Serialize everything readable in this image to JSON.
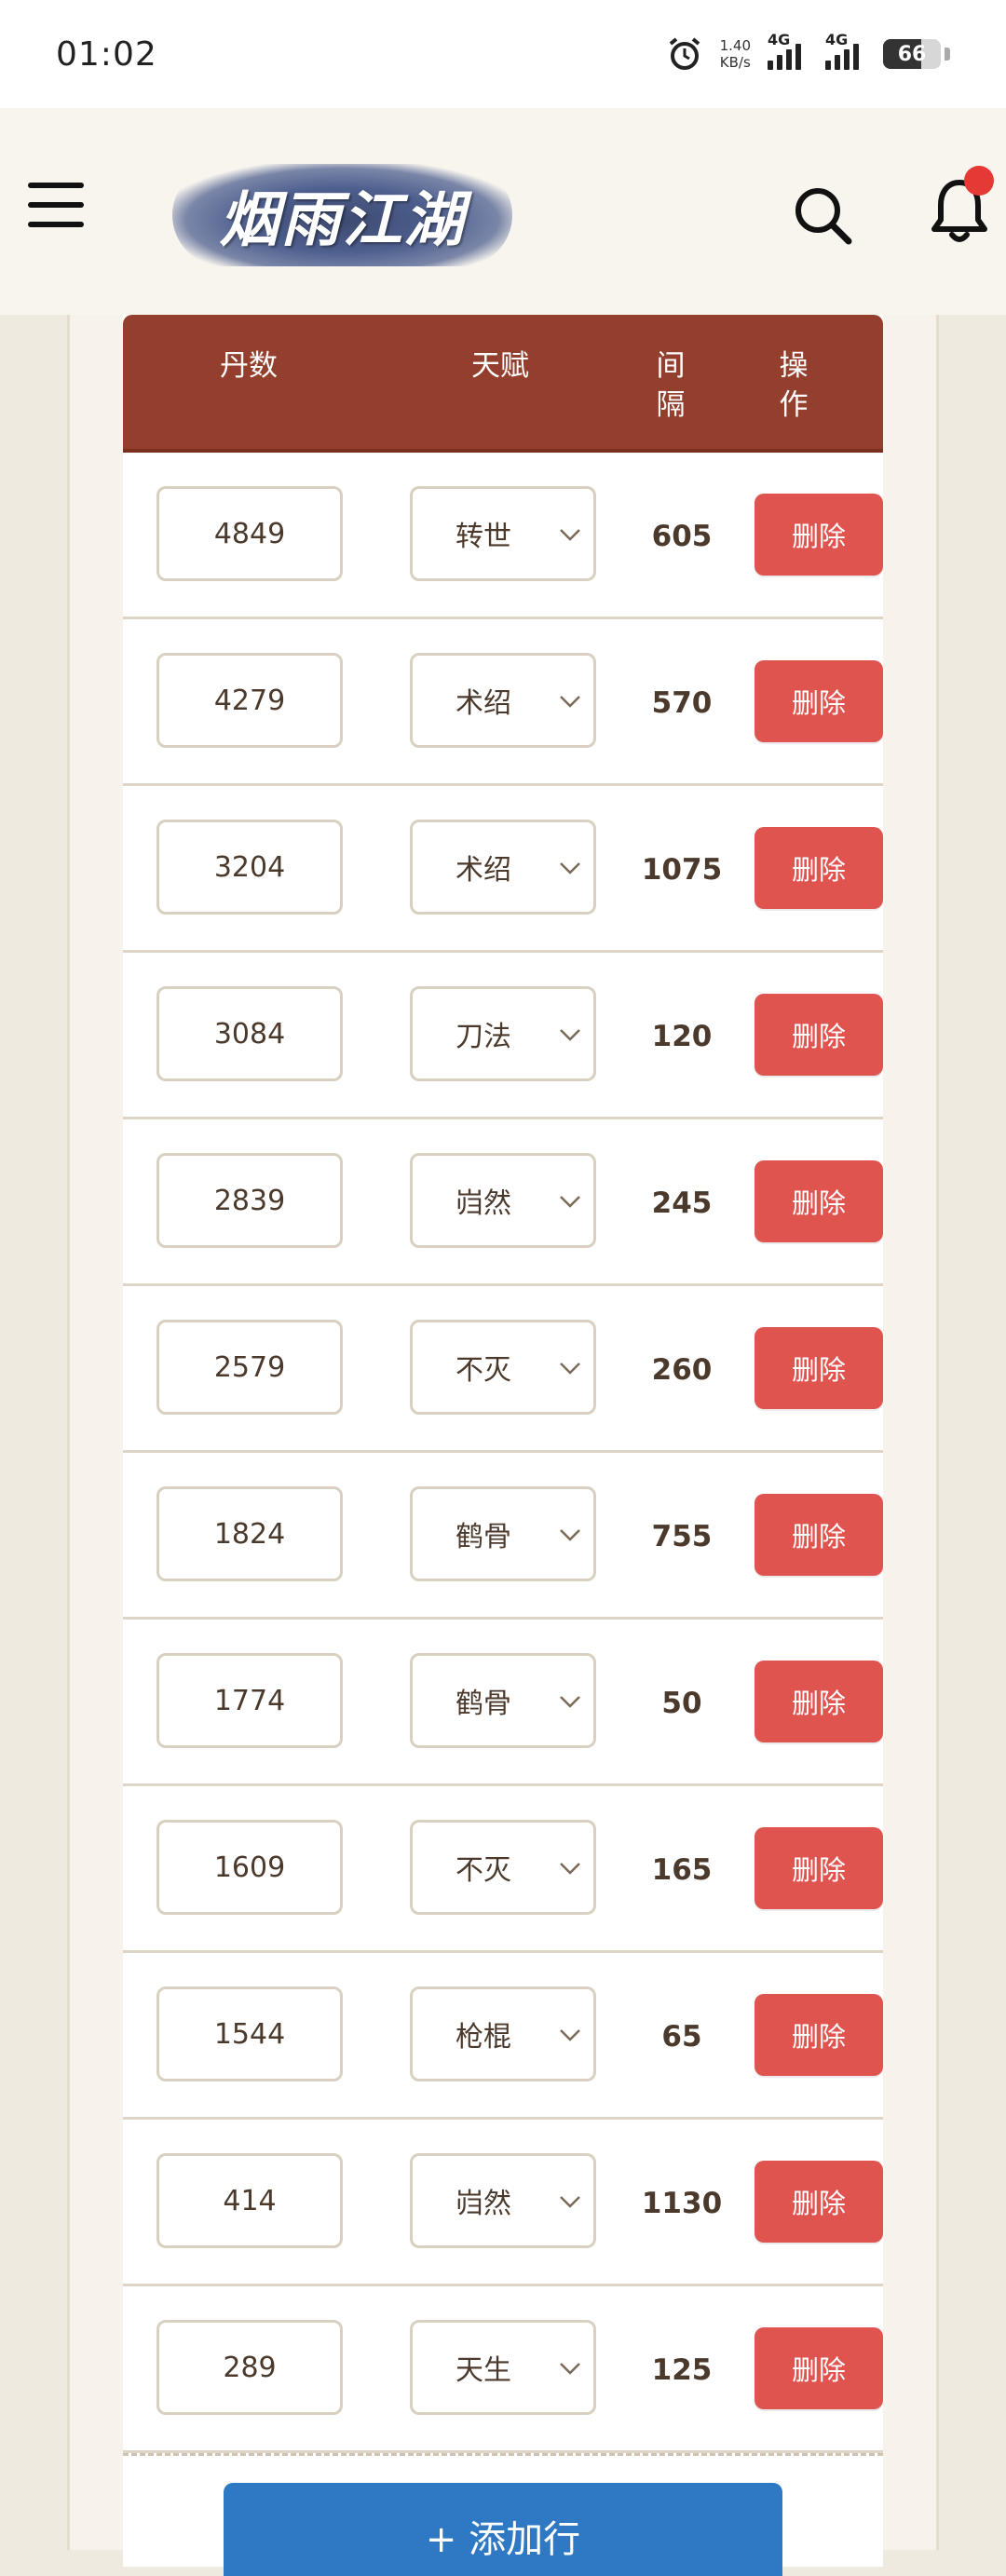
{
  "status_bar": {
    "time": "01:02",
    "netspeed_value": "1.40",
    "netspeed_unit": "KB/s",
    "signal1_label": "4G",
    "signal2_label": "4G",
    "battery": "66"
  },
  "header": {
    "logo_text": "烟雨江湖",
    "notification_dot_color": "#e53935"
  },
  "table": {
    "columns": {
      "count": "丹数",
      "talent": "天赋",
      "interval_line1": "间",
      "interval_line2": "隔",
      "action_line1": "操",
      "action_line2": "作"
    },
    "delete_label": "删除",
    "rows": [
      {
        "count": "4849",
        "talent": "转世",
        "interval": "605"
      },
      {
        "count": "4279",
        "talent": "术绍",
        "interval": "570"
      },
      {
        "count": "3204",
        "talent": "术绍",
        "interval": "1075"
      },
      {
        "count": "3084",
        "talent": "刀法",
        "interval": "120"
      },
      {
        "count": "2839",
        "talent": "岿然",
        "interval": "245"
      },
      {
        "count": "2579",
        "talent": "不灭",
        "interval": "260"
      },
      {
        "count": "1824",
        "talent": "鹤骨",
        "interval": "755"
      },
      {
        "count": "1774",
        "talent": "鹤骨",
        "interval": "50"
      },
      {
        "count": "1609",
        "talent": "不灭",
        "interval": "165"
      },
      {
        "count": "1544",
        "talent": "枪棍",
        "interval": "65"
      },
      {
        "count": "414",
        "talent": "岿然",
        "interval": "1130"
      },
      {
        "count": "289",
        "talent": "天生",
        "interval": "125"
      }
    ],
    "add_row_label": "+ 添加行"
  },
  "colors": {
    "header_bg": "#943f2d",
    "delete_bg": "#e05450",
    "add_bg": "#2f78c4"
  }
}
